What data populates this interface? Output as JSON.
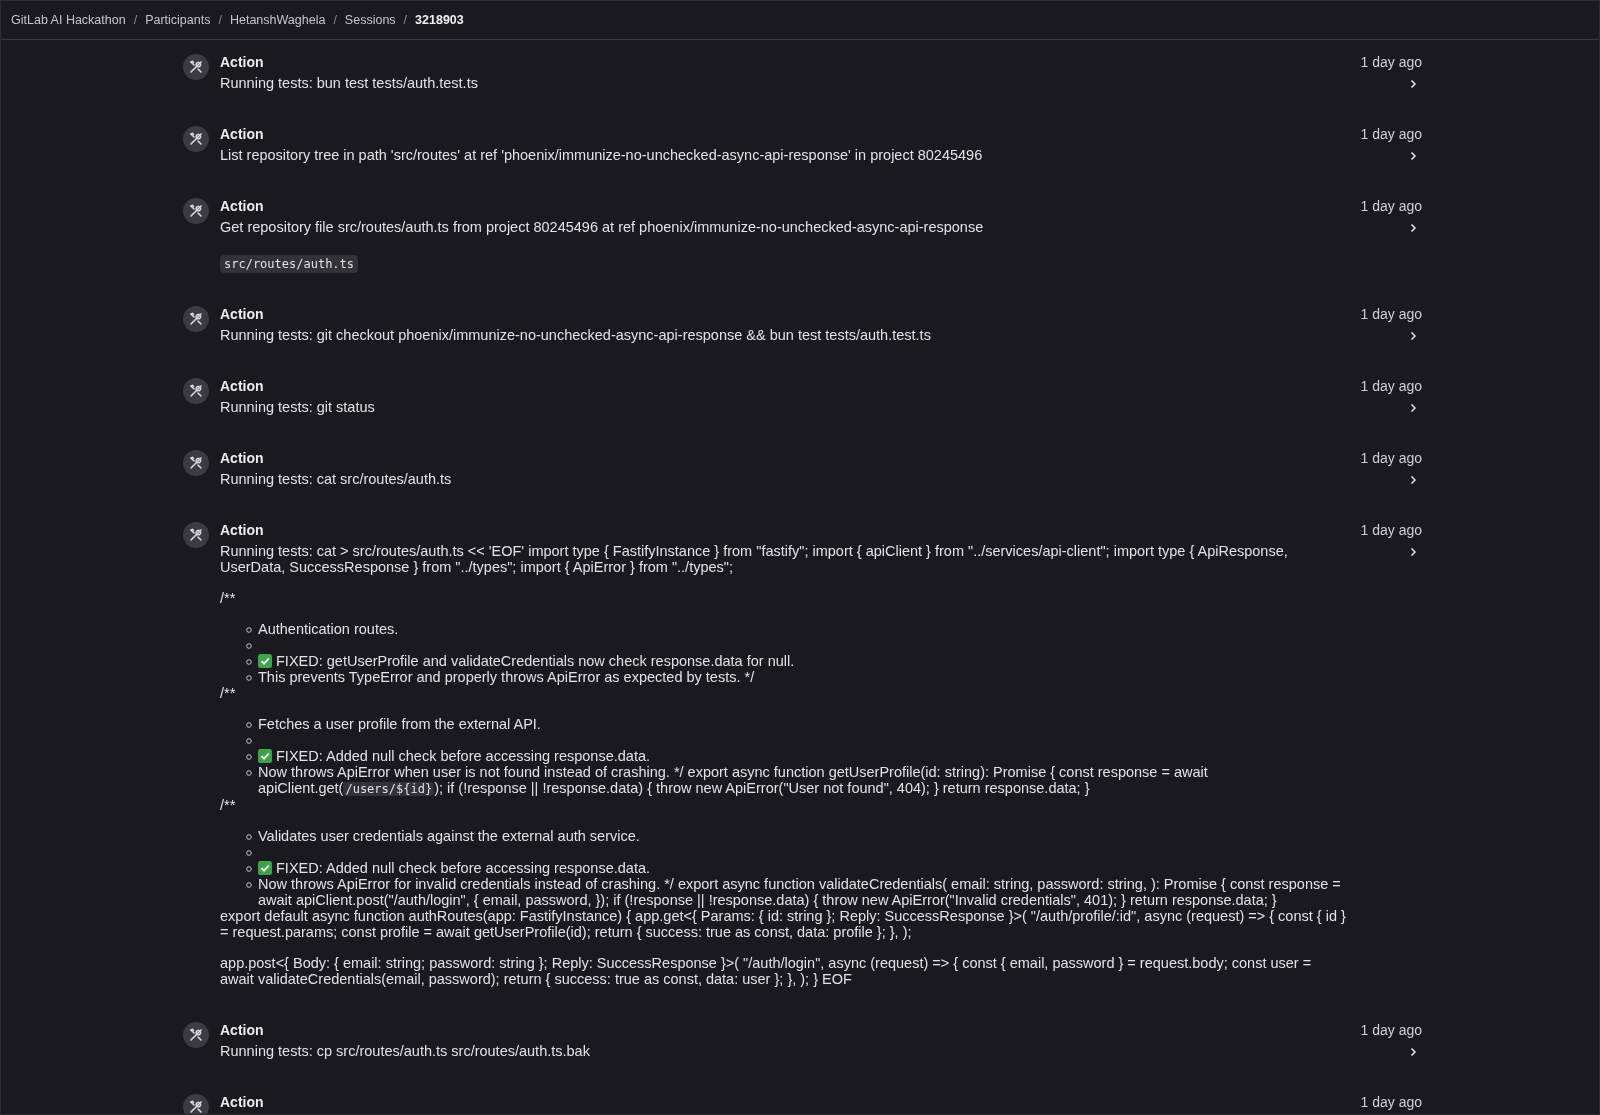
{
  "breadcrumb": {
    "separator": "/",
    "items": [
      {
        "label": "GitLab AI Hackathon",
        "current": false
      },
      {
        "label": "Participants",
        "current": false
      },
      {
        "label": "HetanshWaghela",
        "current": false
      },
      {
        "label": "Sessions",
        "current": false
      },
      {
        "label": "3218903",
        "current": true
      }
    ]
  },
  "entries": [
    {
      "title": "Action",
      "text": "Running tests: bun test tests/auth.test.ts",
      "time": "1 day ago"
    },
    {
      "title": "Action",
      "text": "List repository tree in path 'src/routes' at ref 'phoenix/immunize-no-unchecked-async-api-response' in project 80245496",
      "time": "1 day ago"
    },
    {
      "title": "Action",
      "text": "Get repository file src/routes/auth.ts from project 80245496 at ref phoenix/immunize-no-unchecked-async-api-response",
      "time": "1 day ago",
      "file": "src/routes/auth.ts"
    },
    {
      "title": "Action",
      "text": "Running tests: git checkout phoenix/immunize-no-unchecked-async-api-response && bun test tests/auth.test.ts",
      "time": "1 day ago"
    },
    {
      "title": "Action",
      "text": "Running tests: git status",
      "time": "1 day ago"
    },
    {
      "title": "Action",
      "text": "Running tests: cat src/routes/auth.ts",
      "time": "1 day ago"
    },
    {
      "title": "Action",
      "text": "Running tests: cat > src/routes/auth.ts << 'EOF' import type { FastifyInstance } from \"fastify\"; import { apiClient } from \"../services/api-client\"; import type { ApiResponse, UserData, SuccessResponse } from \"../types\"; import { ApiError } from \"../types\";",
      "time": "1 day ago",
      "blocks": [
        {
          "kind": "para",
          "text": "/**"
        },
        {
          "kind": "list",
          "items": [
            {
              "kind": "text",
              "text": "Authentication routes."
            },
            {
              "kind": "blank"
            },
            {
              "kind": "check",
              "text": "FIXED: getUserProfile and validateCredentials now check response.data for null."
            },
            {
              "kind": "text",
              "text": "This prevents TypeError and properly throws ApiError as expected by tests. */"
            }
          ]
        },
        {
          "kind": "para",
          "text": "/**"
        },
        {
          "kind": "list",
          "items": [
            {
              "kind": "text",
              "text": "Fetches a user profile from the external API."
            },
            {
              "kind": "blank"
            },
            {
              "kind": "check",
              "text": "FIXED: Added null check before accessing response.data."
            },
            {
              "kind": "text",
              "text": "Now throws ApiError when user is not found instead of crashing. */ export async function getUserProfile(id: string): Promise { const response = await apiClient.get(",
              "code": "/users/${id}",
              "after": "); if (!response || !response.data) { throw new ApiError(\"User not found\", 404); } return response.data; }"
            }
          ]
        },
        {
          "kind": "para",
          "text": "/**"
        },
        {
          "kind": "list",
          "items": [
            {
              "kind": "text",
              "text": "Validates user credentials against the external auth service."
            },
            {
              "kind": "blank"
            },
            {
              "kind": "check",
              "text": "FIXED: Added null check before accessing response.data."
            },
            {
              "kind": "text",
              "text": "Now throws ApiError for invalid credentials instead of crashing. */ export async function validateCredentials( email: string, password: string, ): Promise { const response = await apiClient.post(\"/auth/login\", { email, password, }); if (!response || !response.data) { throw new ApiError(\"Invalid credentials\", 401); } return response.data; }"
            }
          ]
        },
        {
          "kind": "para",
          "text": "export default async function authRoutes(app: FastifyInstance) { app.get<{ Params: { id: string }; Reply: SuccessResponse }>( \"/auth/profile/:id\", async (request) => { const { id } = request.params; const profile = await getUserProfile(id); return { success: true as const, data: profile }; }, );"
        },
        {
          "kind": "para",
          "text": "app.post<{ Body: { email: string; password: string }; Reply: SuccessResponse }>( \"/auth/login\", async (request) => { const { email, password } = request.body; const user = await validateCredentials(email, password); return { success: true as const, data: user }; }, ); } EOF"
        }
      ]
    },
    {
      "title": "Action",
      "text": "Running tests: cp src/routes/auth.ts src/routes/auth.ts.bak",
      "time": "1 day ago"
    },
    {
      "title": "Action",
      "time": "1 day ago"
    }
  ]
}
